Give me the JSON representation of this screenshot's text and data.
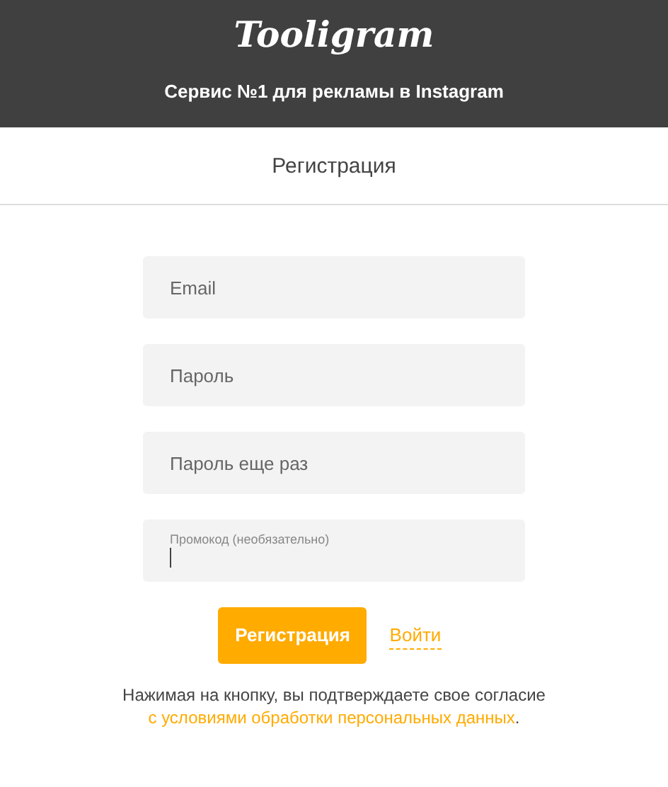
{
  "header": {
    "logo": "Tooligram",
    "tagline": "Сервис №1 для рекламы в Instagram"
  },
  "page_title": "Регистрация",
  "fields": [
    {
      "placeholder": "Email",
      "focused": false
    },
    {
      "placeholder": "Пароль",
      "focused": false
    },
    {
      "placeholder": "Пароль еще раз",
      "focused": false
    },
    {
      "placeholder": "Промокод (необязательно)",
      "focused": true
    }
  ],
  "submit_button": "Регистрация",
  "login_link": "Войти",
  "consent": {
    "text": "Нажимая на кнопку, вы подтверждаете свое согласие",
    "link": "с условиями обработки персональных данных",
    "end": "."
  }
}
